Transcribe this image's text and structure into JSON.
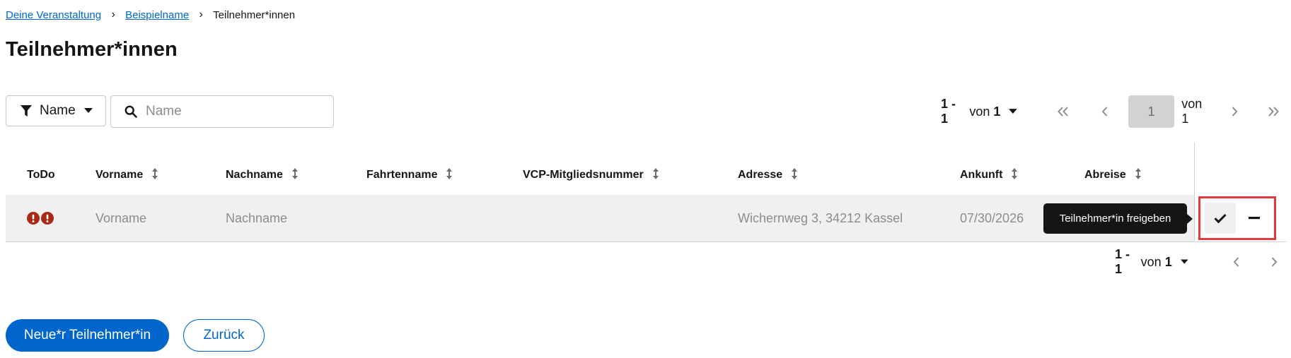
{
  "breadcrumb": {
    "items": [
      {
        "label": "Deine Veranstaltung"
      },
      {
        "label": "Beispielname"
      },
      {
        "label": "Teilnehmer*innen"
      }
    ]
  },
  "page": {
    "title": "Teilnehmer*innen"
  },
  "toolbar": {
    "filter_label": "Name",
    "search_placeholder": "Name",
    "search_value": ""
  },
  "pagination_top": {
    "range": "1 - 1",
    "von": "von",
    "total": "1",
    "current_page": "1",
    "of_pages": "von 1"
  },
  "table": {
    "columns": [
      "ToDo",
      "Vorname",
      "Nachname",
      "Fahrtenname",
      "VCP-Mitgliedsnummer",
      "Adresse",
      "Ankunft",
      "Abreise"
    ],
    "rows": [
      {
        "vorname": "Vorname",
        "nachname": "Nachname",
        "fahrtenname": "",
        "vcp": "",
        "adresse": "Wichernweg 3, 34212 Kassel",
        "ankunft": "07/30/2026"
      }
    ]
  },
  "tooltip": {
    "text": "Teilnehmer*in freigeben"
  },
  "pagination_bottom": {
    "range": "1 - 1",
    "von": "von",
    "total": "1"
  },
  "actions": {
    "new_label": "Neue*r Teilnehmer*in",
    "back_label": "Zurück"
  },
  "colors": {
    "primary": "#0066cc",
    "danger": "#c9190b",
    "highlight": "#e0393e"
  },
  "icons": [
    "filter-icon",
    "caret-down-icon",
    "search-icon",
    "angle-double-left-icon",
    "angle-left-icon",
    "angle-right-icon",
    "angle-double-right-icon",
    "sort-icon",
    "exclamation-circle-icon",
    "check-icon",
    "minus-icon",
    "breadcrumb-separator-icon"
  ]
}
